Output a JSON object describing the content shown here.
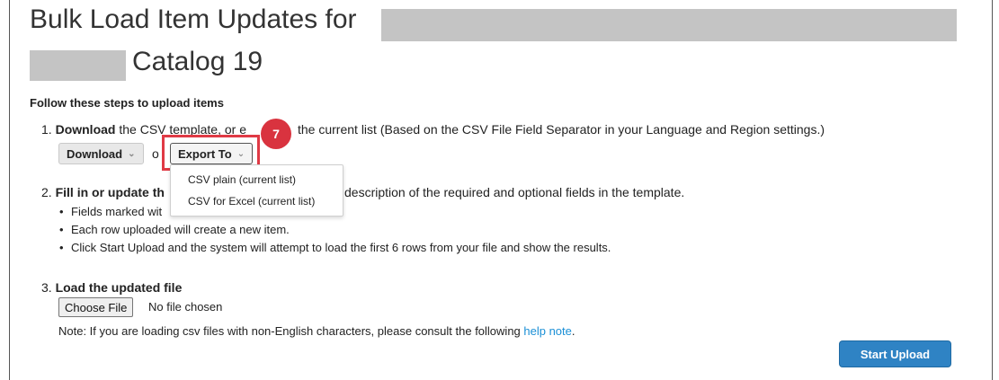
{
  "title": {
    "line1": "Bulk Load Item Updates for",
    "line2": "Catalog 19"
  },
  "steps_heading": "Follow these steps to upload items",
  "step1": {
    "number": "1.",
    "bold": "Download",
    "text_a": " the CSV template, or e",
    "text_b": "the current list (Based on the CSV File Field Separator in your Language and Region settings.)",
    "download_label": "Download",
    "or": "o",
    "export_label": "Export To"
  },
  "annotation_badge": "7",
  "export_menu": {
    "items": [
      "CSV plain (current list)",
      "CSV for Excel (current list)"
    ]
  },
  "step2": {
    "number": "2.",
    "bold": "Fill in or update th",
    "text": "description of the required and optional fields in the template.",
    "bullets": [
      "Fields marked wit",
      "Each row uploaded will create a new item.",
      "Click Start Upload and the system will attempt to load the first 6 rows from your file and show the results."
    ]
  },
  "step3": {
    "number": "3.",
    "bold": "Load the updated file",
    "choose_file_label": "Choose File",
    "no_file_text": "No file chosen",
    "note_text": "Note: If you are loading csv files with non-English characters, please consult the following ",
    "help_link": "help note",
    "note_end": "."
  },
  "start_upload_label": "Start Upload",
  "icons": {
    "dropdown": "chevron-down-icon"
  },
  "colors": {
    "accent": "#2f83c4",
    "annotation": "#d9333f",
    "link": "#1a8fd6"
  }
}
